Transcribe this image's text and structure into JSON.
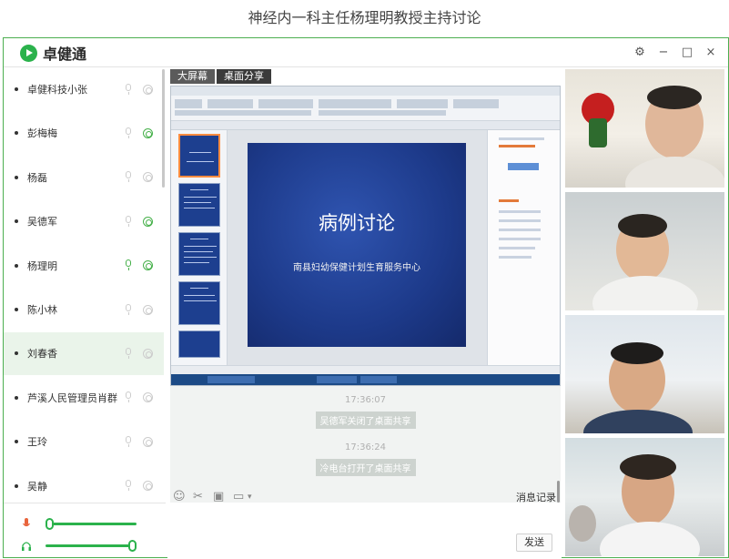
{
  "page_title": "神经内一科主任杨理明教授主持讨论",
  "app": {
    "name": "卓健通",
    "window_buttons": {
      "settings": "⚙",
      "minimize": "−",
      "maximize": "□",
      "close": "×"
    }
  },
  "participants": [
    {
      "name": "卓健科技小张",
      "mic_on": false,
      "cam_on": false
    },
    {
      "name": "彭梅梅",
      "mic_on": false,
      "cam_on": true
    },
    {
      "name": "杨磊",
      "mic_on": false,
      "cam_on": false
    },
    {
      "name": "吴德军",
      "mic_on": false,
      "cam_on": true
    },
    {
      "name": "杨理明",
      "mic_on": true,
      "cam_on": true
    },
    {
      "name": "陈小林",
      "mic_on": false,
      "cam_on": false
    },
    {
      "name": "刘春香",
      "mic_on": false,
      "cam_on": false,
      "active": true
    },
    {
      "name": "芦溪人民管理员肖群",
      "mic_on": false,
      "cam_on": false
    },
    {
      "name": "王玲",
      "mic_on": false,
      "cam_on": false
    },
    {
      "name": "吴静",
      "mic_on": false,
      "cam_on": false
    }
  ],
  "volume": {
    "mic_level": 0.0,
    "speaker_level": 1.0
  },
  "share": {
    "tabs": [
      "大屏幕",
      "桌面分享"
    ],
    "selected_tab": "桌面分享",
    "slide": {
      "title": "病例讨论",
      "subtitle": "南县妇幼保健计划生育服务中心"
    }
  },
  "chat": {
    "messages": [
      {
        "time": "17:36:07",
        "text": "吴德军关闭了桌面共享"
      },
      {
        "time": "17:36:24",
        "text": "冷电台打开了桌面共享"
      }
    ],
    "history_label": "消息记录",
    "send_label": "发送"
  },
  "colors": {
    "accent": "#2bb24c",
    "border": "#4caf50",
    "slide_bg": "#1d3a8a"
  }
}
